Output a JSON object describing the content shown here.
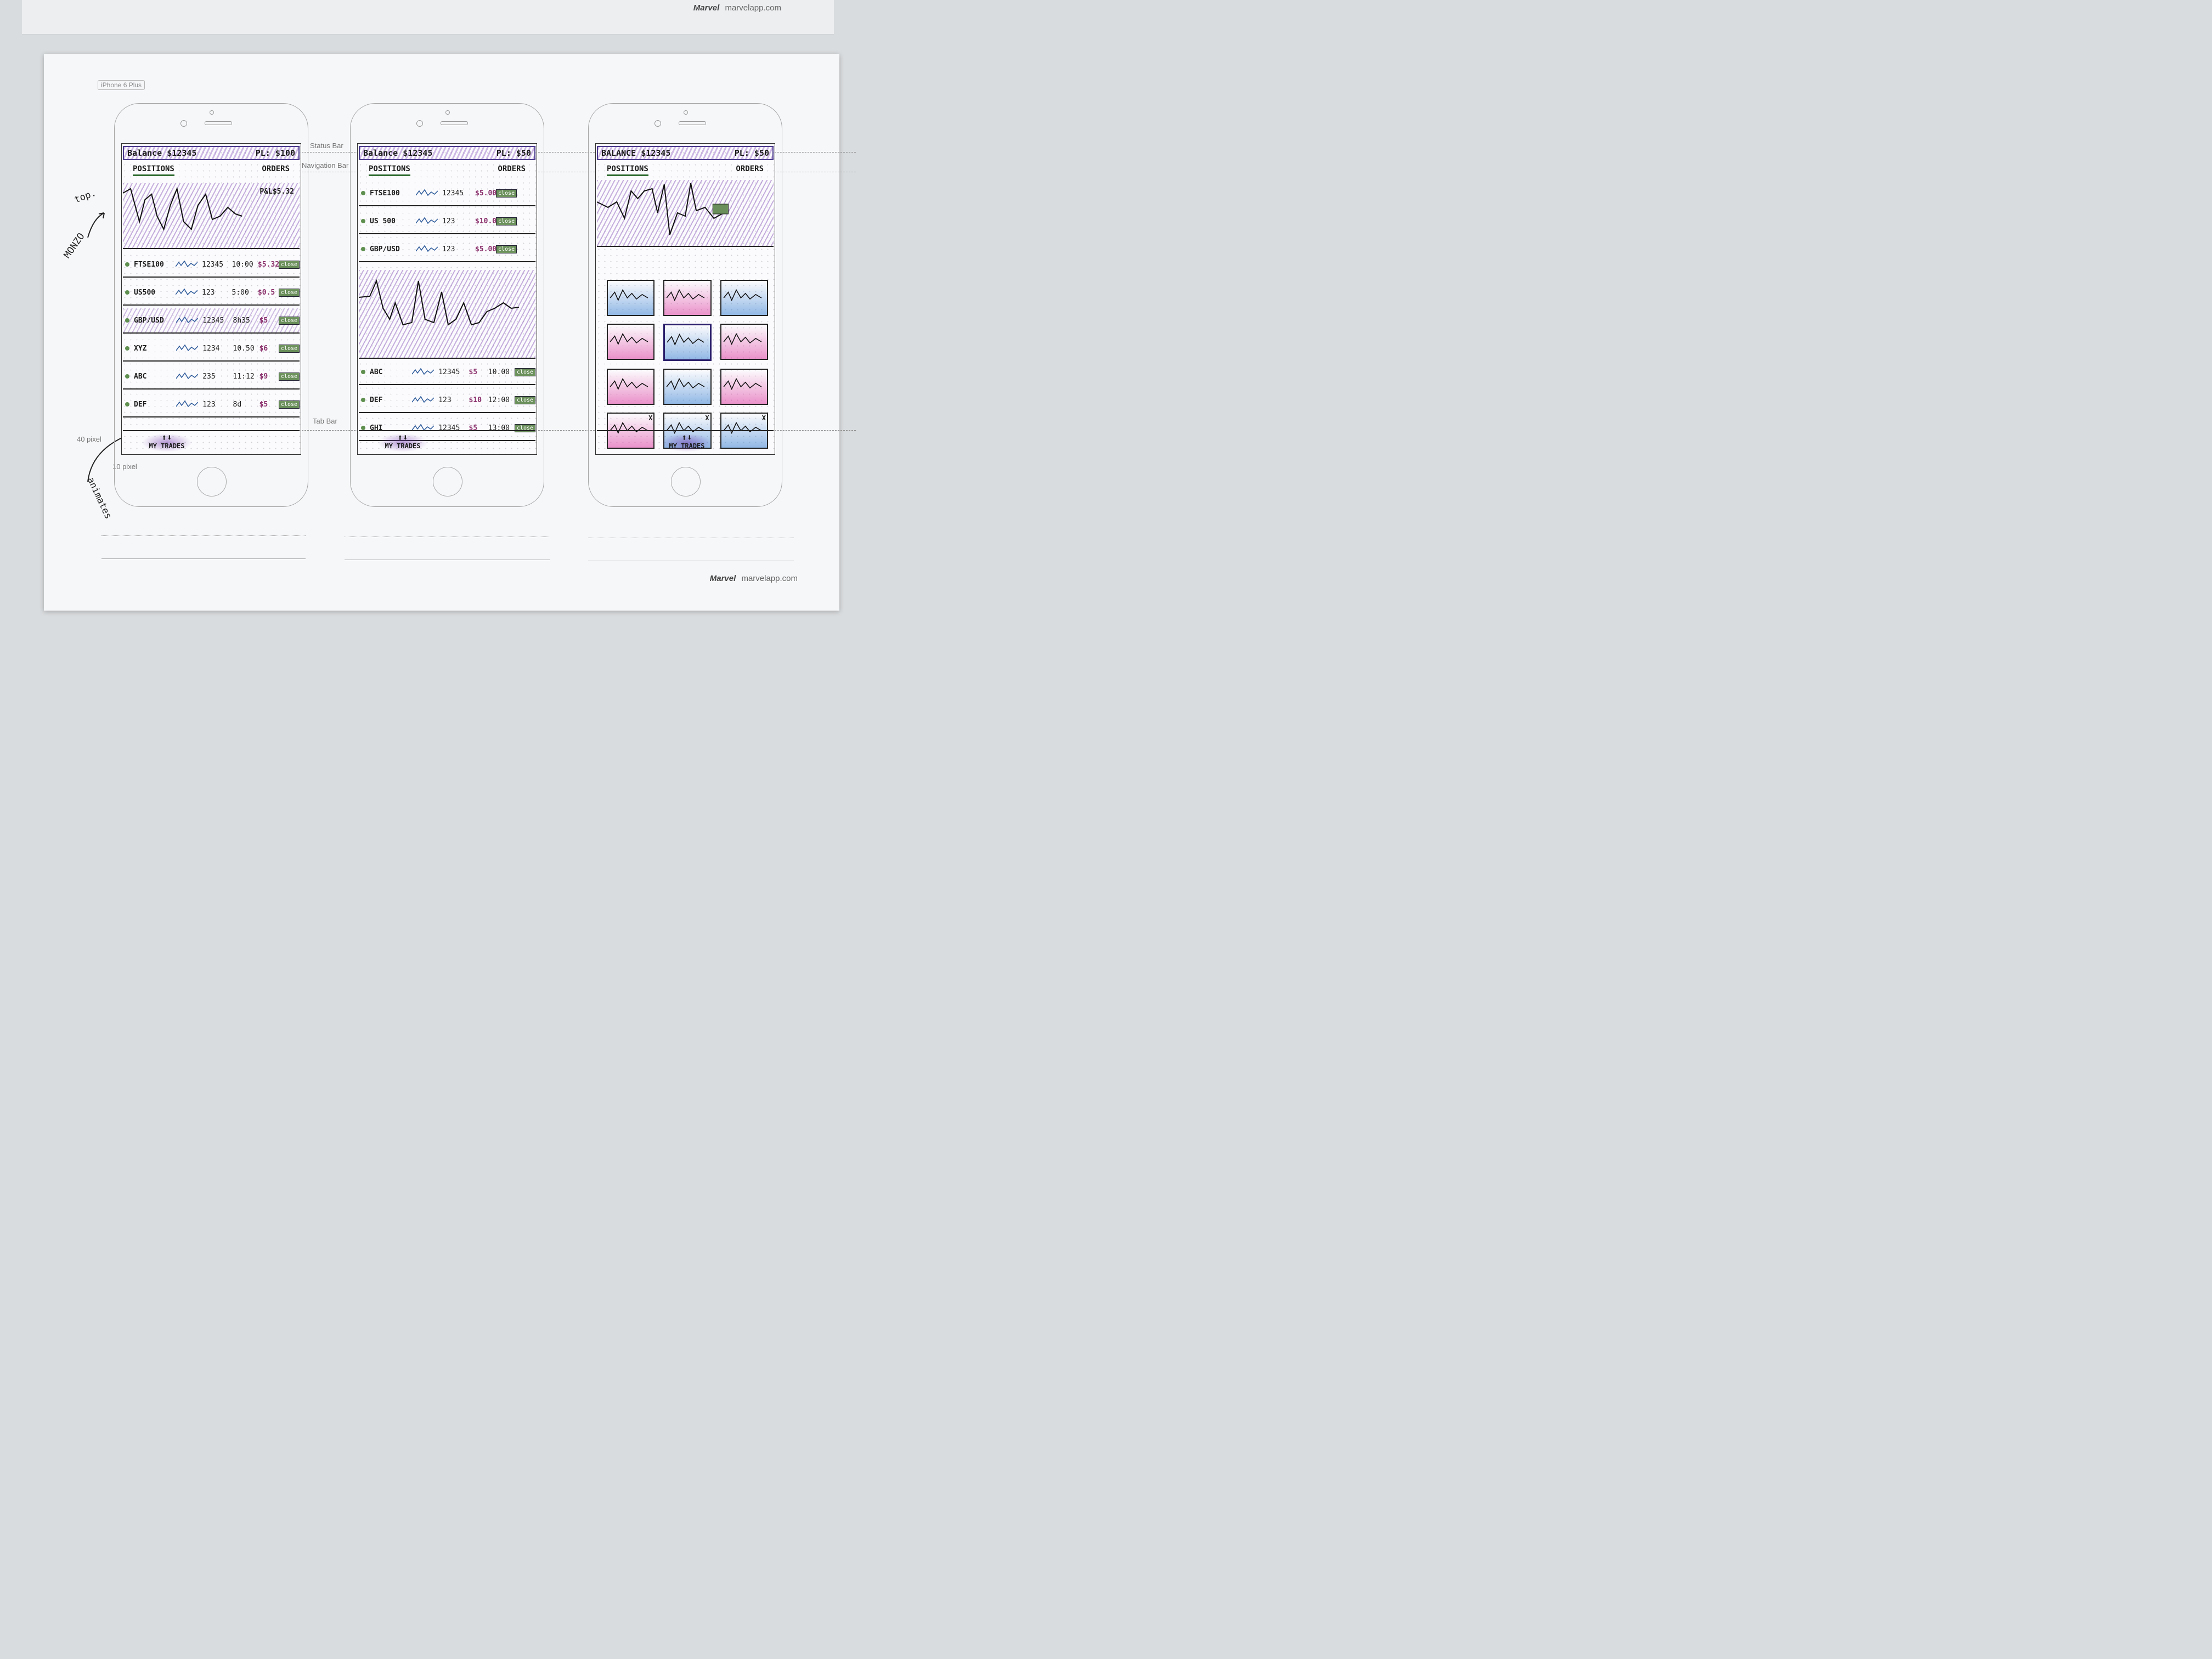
{
  "header_brand": {
    "logo": "Marvel",
    "url": "marvelapp.com"
  },
  "device_label": "iPhone 6 Plus",
  "annotations": {
    "status_bar": "Status Bar",
    "navigation_bar": "Navigation Bar",
    "tab_bar": "Tab Bar",
    "px40": "40 pixel",
    "px10": "10 pixel",
    "note_top": "top.",
    "note_monzo": "MONZO",
    "note_animates": "animates"
  },
  "footer_brand": {
    "logo": "Marvel",
    "url": "marvelapp.com"
  },
  "screens": [
    {
      "balance": "Balance $12345",
      "pl": "PL: $100",
      "tabs": [
        "POSITIONS",
        "ORDERS"
      ],
      "chart_pl": "P&L$5.32",
      "rows": [
        {
          "symbol": "FTSE100",
          "qty": "12345",
          "time": "10:00",
          "amount": "$5.32",
          "action": "close"
        },
        {
          "symbol": "US500",
          "qty": "123",
          "time": "5:00",
          "amount": "$0.5",
          "action": "close"
        },
        {
          "symbol": "GBP/USD",
          "qty": "12345",
          "time": "8h35",
          "amount": "$5",
          "action": "close"
        },
        {
          "symbol": "XYZ",
          "qty": "1234",
          "time": "10.50",
          "amount": "$6",
          "action": "close"
        },
        {
          "symbol": "ABC",
          "qty": "235",
          "time": "11:12",
          "amount": "$9",
          "action": "close"
        },
        {
          "symbol": "DEF",
          "qty": "123",
          "time": "8d",
          "amount": "$5",
          "action": "close"
        }
      ],
      "tab_bar_label": "MY TRADES"
    },
    {
      "balance": "Balance $12345",
      "pl": "PL: $50",
      "tabs": [
        "POSITIONS",
        "ORDERS"
      ],
      "rows_top": [
        {
          "symbol": "FTSE100",
          "qty": "12345",
          "amount": "$5.00",
          "action": "close"
        },
        {
          "symbol": "US 500",
          "qty": "123",
          "amount": "$10.00",
          "action": "close"
        },
        {
          "symbol": "GBP/USD",
          "qty": "123",
          "amount": "$5.00",
          "action": "close"
        }
      ],
      "rows_bottom": [
        {
          "symbol": "ABC",
          "qty": "12345",
          "amount": "$5",
          "time": "10.00",
          "action": "close"
        },
        {
          "symbol": "DEF",
          "qty": "123",
          "amount": "$10",
          "time": "12:00",
          "action": "close"
        },
        {
          "symbol": "GHI",
          "qty": "12345",
          "amount": "$5",
          "time": "13:00",
          "action": "close"
        }
      ],
      "tab_bar_label": "MY TRADES"
    },
    {
      "balance": "BALANCE $12345",
      "pl": "PL: $50",
      "tabs": [
        "POSITIONS",
        "ORDERS"
      ],
      "tiles": [
        {
          "color": "blue"
        },
        {
          "color": "pink"
        },
        {
          "color": "blue"
        },
        {
          "color": "pink"
        },
        {
          "color": "blue",
          "selected": true
        },
        {
          "color": "pink"
        },
        {
          "color": "pink"
        },
        {
          "color": "blue"
        },
        {
          "color": "pink"
        },
        {
          "color": "pink",
          "close": "X"
        },
        {
          "color": "blue",
          "close": "X"
        },
        {
          "color": "blue",
          "close": "X"
        }
      ],
      "tab_bar_label": "MY TRADES"
    }
  ],
  "colors": {
    "purple": "#6e32aa",
    "pink": "#dc3ca0",
    "blue": "#3c82d2",
    "green": "#5f8f4f"
  }
}
